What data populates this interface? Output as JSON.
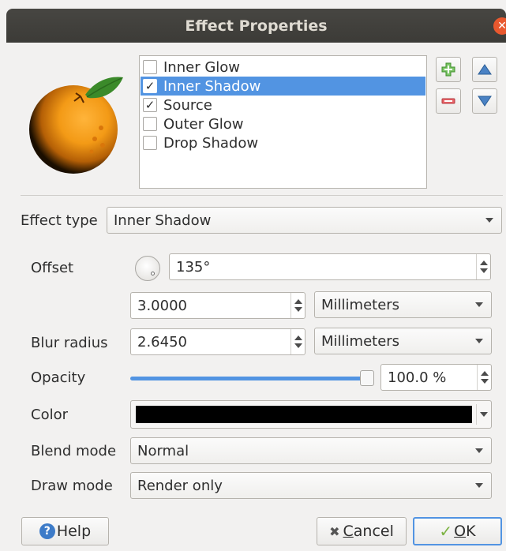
{
  "window": {
    "title": "Effect Properties",
    "close_glyph": "✕"
  },
  "preview": {
    "icon": "orange-fruit-icon"
  },
  "effects": {
    "items": [
      {
        "label": "Inner Glow",
        "checked": false,
        "selected": false
      },
      {
        "label": "Inner Shadow",
        "checked": true,
        "selected": true
      },
      {
        "label": "Source",
        "checked": true,
        "selected": false
      },
      {
        "label": "Outer Glow",
        "checked": false,
        "selected": false
      },
      {
        "label": "Drop Shadow",
        "checked": false,
        "selected": false
      }
    ],
    "check_glyph": "✓",
    "buttons": {
      "add_icon": "add-icon",
      "remove_icon": "remove-icon",
      "up_icon": "arrow-up-icon",
      "down_icon": "arrow-down-icon"
    }
  },
  "form": {
    "effect_type_label": "Effect type",
    "effect_type_value": "Inner Shadow",
    "offset_label": "Offset",
    "offset_angle": "135°",
    "offset_distance": "3.0000",
    "offset_unit": "Millimeters",
    "blur_label": "Blur radius",
    "blur_value": "2.6450",
    "blur_unit": "Millimeters",
    "opacity_label": "Opacity",
    "opacity_value": "100.0 %",
    "opacity_fraction": 1.0,
    "color_label": "Color",
    "color_value": "#000000",
    "blend_label": "Blend mode",
    "blend_value": "Normal",
    "draw_label": "Draw mode",
    "draw_value": "Render only"
  },
  "footer": {
    "help_label": "Help",
    "help_glyph": "?",
    "cancel_label_first": "C",
    "cancel_label_rest": "ancel",
    "cancel_glyph": "✖",
    "ok_label_first": "O",
    "ok_label_rest": "K",
    "ok_glyph": "✓"
  },
  "colors": {
    "selection": "#5294e2",
    "title_bg": "#3c3b37",
    "close": "#e9582e"
  }
}
